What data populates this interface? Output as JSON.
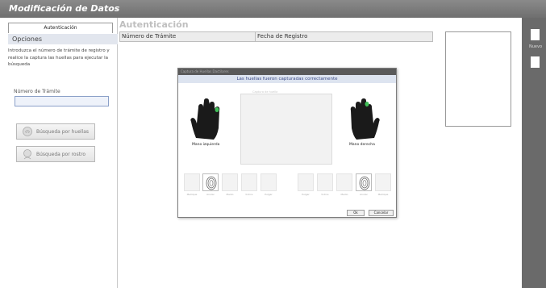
{
  "window": {
    "title": "Modificación de Datos"
  },
  "left": {
    "tab_label": "Autenticación",
    "opciones_label": "Opciones",
    "instructions": "Introduzca el número de trámite de registro y realice la captura las huellas para ejecutar la búsqueda",
    "num_label": "Número de Trámite",
    "num_value": "",
    "btn_huellas": "Búsqueda por huellas",
    "btn_rostro": "Búsqueda por rostro"
  },
  "main": {
    "header": "Autenticación",
    "columns": [
      "Número de Trámite",
      "Fecha de Registro"
    ]
  },
  "sidebar": {
    "item1": "Nuevo"
  },
  "dialog": {
    "title": "Captura de Huellas Dactilares",
    "status": "Las huellas fueron capturadas correctamente",
    "scan_header": "Captura de huella",
    "left_hand": "Mano izquierda",
    "right_hand": "Mano derecha",
    "left_fingers": [
      "Meñique",
      "Anular",
      "Medio",
      "Índice",
      "Pulgar"
    ],
    "right_fingers": [
      "Pulgar",
      "Índice",
      "Medio",
      "Anular",
      "Meñique"
    ],
    "ok": "Ok",
    "cancel": "Cancelar",
    "accent_green": "#3fbf57"
  }
}
